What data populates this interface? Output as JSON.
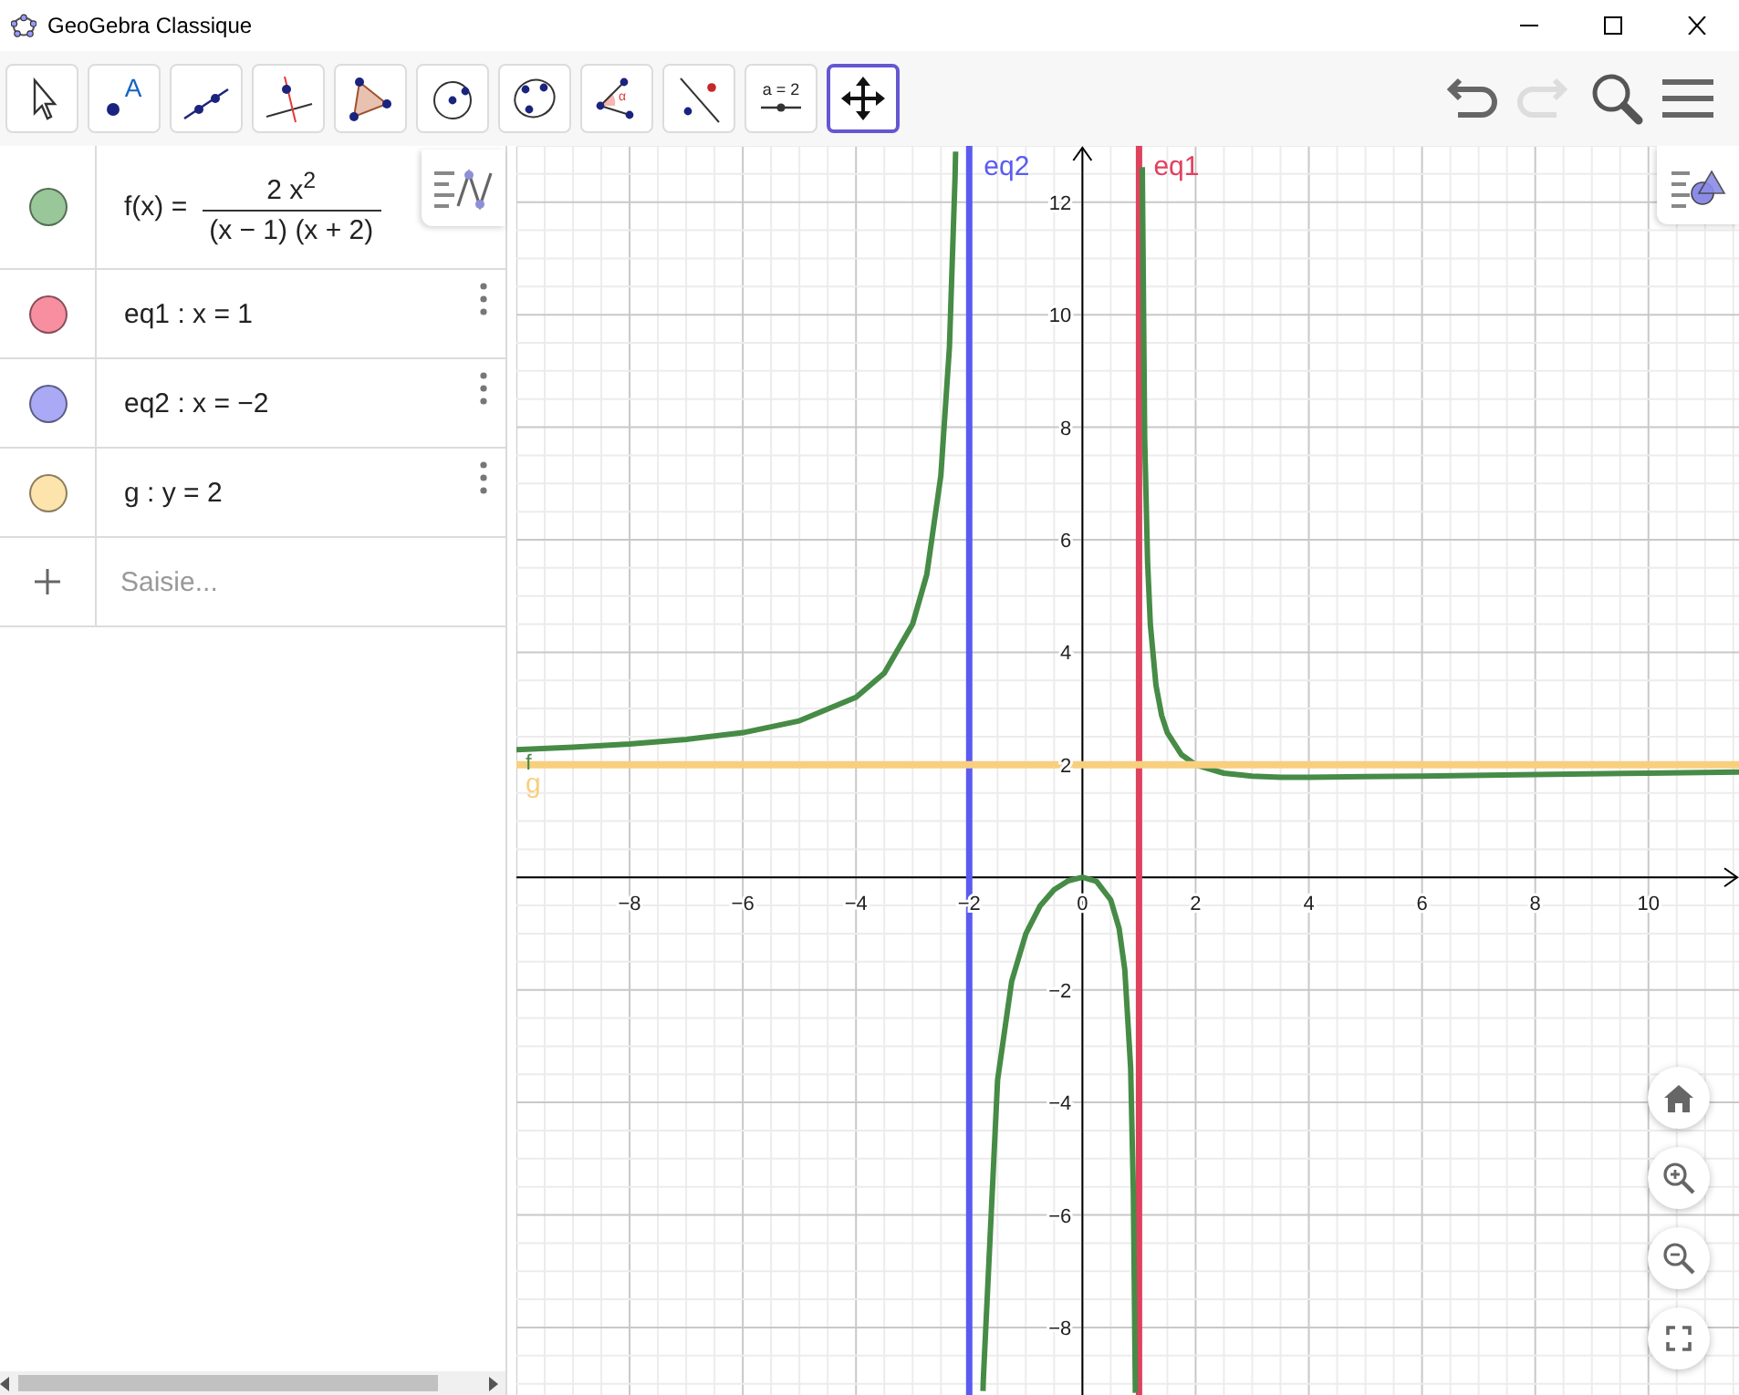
{
  "window": {
    "title": "GeoGebra Classique"
  },
  "toolbar": {
    "tools": [
      {
        "kind": "pointer",
        "selected": false
      },
      {
        "kind": "point",
        "label": "A",
        "selected": false
      },
      {
        "kind": "line",
        "selected": false
      },
      {
        "kind": "perpendicular",
        "selected": false
      },
      {
        "kind": "polygon",
        "selected": false
      },
      {
        "kind": "circle",
        "selected": false
      },
      {
        "kind": "conic",
        "selected": false
      },
      {
        "kind": "angle",
        "label": "α",
        "selected": false
      },
      {
        "kind": "reflect",
        "selected": false
      },
      {
        "kind": "slider",
        "label": "a = 2",
        "selected": false
      },
      {
        "kind": "move-graphics",
        "selected": true
      }
    ],
    "undo": {
      "disabled": false
    },
    "redo": {
      "disabled": true
    }
  },
  "algebra": {
    "rows": [
      {
        "kind": "fraction",
        "color": "#99c799",
        "lhs": "f(x) =",
        "numerator": "2 x$^{2}$",
        "denominator": "(x − 1) (x + 2)",
        "menu": false
      },
      {
        "kind": "plain",
        "color": "#f78fa0",
        "text": "eq1 : x = 1",
        "menu": true
      },
      {
        "kind": "plain",
        "color": "#a9a9f5",
        "text": "eq2 : x = −2",
        "menu": true
      },
      {
        "kind": "plain",
        "color": "#fde3ac",
        "text": "g : y = 2",
        "menu": true
      }
    ],
    "input": {
      "placeholder": "Saisie..."
    }
  },
  "graph": {
    "chart_data": {
      "type": "line",
      "grid": true,
      "xlim": [
        -10,
        11.6
      ],
      "ylim": [
        -9.2,
        13
      ],
      "xticks": [
        {
          "value": -8,
          "label": "−8"
        },
        {
          "value": -6,
          "label": "−6"
        },
        {
          "value": -4,
          "label": "−4"
        },
        {
          "value": -2,
          "label": "−2"
        },
        {
          "value": 0,
          "label": "0"
        },
        {
          "value": 2,
          "label": "2"
        },
        {
          "value": 4,
          "label": "4"
        },
        {
          "value": 6,
          "label": "6"
        },
        {
          "value": 8,
          "label": "8"
        },
        {
          "value": 10,
          "label": "10"
        }
      ],
      "yticks": [
        {
          "value": -8,
          "label": "−8"
        },
        {
          "value": -6,
          "label": "−6"
        },
        {
          "value": -4,
          "label": "−4"
        },
        {
          "value": -2,
          "label": "−2"
        },
        {
          "value": 2,
          "label": "2"
        },
        {
          "value": 4,
          "label": "4"
        },
        {
          "value": 6,
          "label": "6"
        },
        {
          "value": 8,
          "label": "8"
        },
        {
          "value": 10,
          "label": "10"
        },
        {
          "value": 12,
          "label": "12"
        }
      ],
      "x": [
        -10,
        -9,
        -8,
        -7,
        -6,
        -5,
        -4,
        -3.5,
        -3,
        -2.75,
        -2.5,
        -2.35,
        -2.25,
        -2.24,
        -2,
        -1.755,
        -1.75,
        -1.5,
        -1.25,
        -1,
        -0.75,
        -0.5,
        -0.25,
        0,
        0.25,
        0.5,
        0.65,
        0.75,
        0.85,
        0.9,
        0.935,
        1,
        1.058,
        1.1,
        1.15,
        1.2,
        1.3,
        1.4,
        1.5,
        1.75,
        2,
        2.5,
        3,
        3.5,
        4,
        5,
        6,
        8,
        10,
        11.6
      ],
      "series": [
        {
          "name": "f",
          "color": "#468b46",
          "values": [
            2.27,
            2.31,
            2.37,
            2.45,
            2.57,
            2.78,
            3.2,
            3.63,
            4.5,
            5.38,
            7.14,
            9.42,
            12.46,
            12.9,
            null,
            -9.13,
            -8.91,
            -3.6,
            -1.85,
            -1,
            -0.51,
            -0.22,
            -0.06,
            0,
            -0.07,
            -0.4,
            -0.91,
            -1.64,
            -3.38,
            -5.59,
            -9.16,
            null,
            12.62,
            7.81,
            5.6,
            4.5,
            3.41,
            2.88,
            2.57,
            2.18,
            2,
            1.85,
            1.8,
            1.78,
            1.78,
            1.79,
            1.8,
            1.83,
            1.85,
            1.87
          ]
        },
        {
          "name": "g",
          "color": "#f8cf7f",
          "values": [
            2,
            2,
            2,
            2,
            2,
            2,
            2,
            2,
            2,
            2,
            2,
            2,
            2,
            2,
            2,
            2,
            2,
            2,
            2,
            2,
            2,
            2,
            2,
            2,
            2,
            2,
            2,
            2,
            2,
            2,
            2,
            2,
            2,
            2,
            2,
            2,
            2,
            2,
            2,
            2,
            2,
            2,
            2,
            2,
            2,
            2,
            2,
            2,
            2,
            2
          ]
        }
      ],
      "ref_lines": [
        {
          "axis": "x",
          "value": -2,
          "label": "eq2",
          "color": "#5b5bf0"
        },
        {
          "axis": "x",
          "value": 1,
          "label": "eq1",
          "color": "#e0415e"
        }
      ]
    }
  }
}
